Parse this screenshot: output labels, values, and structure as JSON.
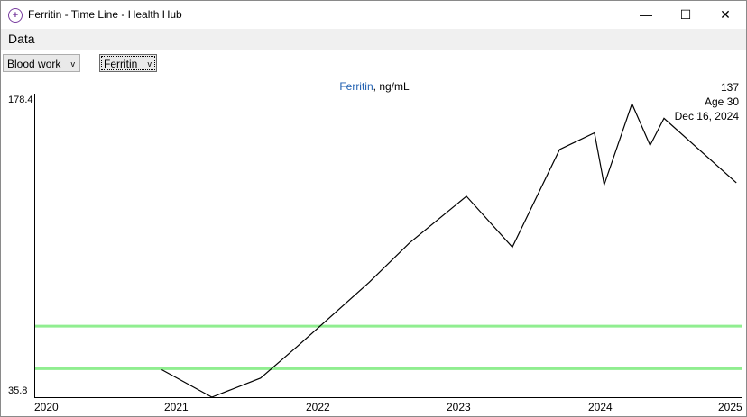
{
  "window": {
    "title": "Ferritin - Time Line - Health Hub",
    "app_icon": "health-plus-icon",
    "minimize_glyph": "—",
    "maximize_glyph": "☐",
    "close_glyph": "✕"
  },
  "menu": {
    "items": [
      "Data"
    ]
  },
  "toolbar": {
    "category": {
      "selected": "Blood work",
      "arrow": "v"
    },
    "measure": {
      "selected": "Ferritin",
      "arrow": "v"
    }
  },
  "chart": {
    "series_name": "Ferritin",
    "unit": ", ng/mL",
    "readout": {
      "value": "137",
      "age": "Age 30",
      "date": "Dec 16, 2024"
    },
    "y_max_label": "178.4",
    "y_min_label": "35.8",
    "x_ticks": [
      "2020",
      "2021",
      "2022",
      "2023",
      "2024",
      "2025"
    ]
  },
  "chart_data": {
    "type": "line",
    "title": "Ferritin, ng/mL",
    "xlabel": "",
    "ylabel": "",
    "ylim": [
      35.8,
      178.4
    ],
    "xlim": [
      2020.0,
      2025.0
    ],
    "grid": false,
    "series": [
      {
        "name": "Ferritin",
        "x": [
          2020.91,
          2021.27,
          2021.62,
          2021.88,
          2022.4,
          2022.69,
          2023.1,
          2023.43,
          2023.77,
          2024.02,
          2024.09,
          2024.29,
          2024.42,
          2024.52,
          2025.04
        ],
        "y": [
          49.0,
          35.8,
          45.0,
          60.0,
          91.0,
          110.0,
          132.5,
          108.0,
          155.0,
          163.0,
          138.0,
          177.0,
          157.0,
          170.0,
          139.0
        ]
      }
    ],
    "reference_band": {
      "low": 49.5,
      "high": 70.0,
      "color": "#90ee90"
    },
    "line_color": "#000000"
  }
}
